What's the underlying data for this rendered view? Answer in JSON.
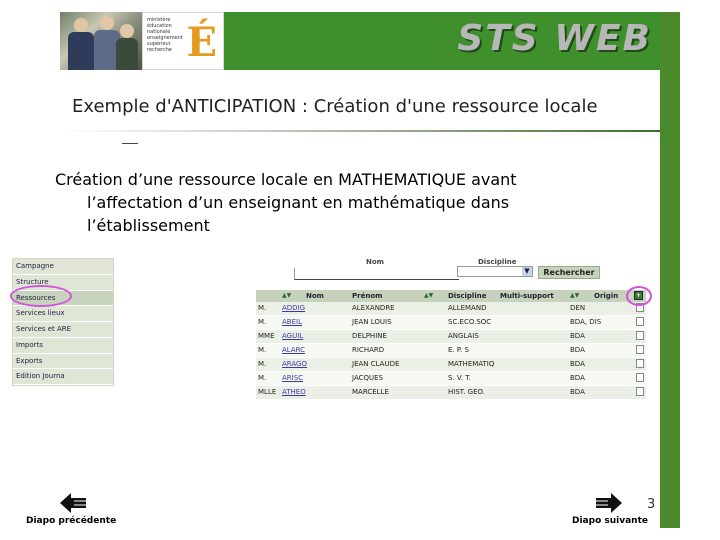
{
  "header": {
    "logo_text": [
      "ministère",
      "éducation",
      "nationale",
      "enseignement",
      "supérieur",
      "recherche"
    ],
    "logo_mark": "É",
    "brand": "STS WEB"
  },
  "slide": {
    "title": "Exemple d'ANTICIPATION : Création d'une ressource locale",
    "body_lines": [
      "Création d’une ressource locale en MATHEMATIQUE avant",
      "l’affectation d’un enseignant en mathématique dans",
      "l’établissement"
    ],
    "page_number": "3"
  },
  "menu": {
    "items": [
      "Campagne",
      "Structure",
      "Ressources",
      "Services lieux",
      "Services et ARE",
      "Imports",
      "Exports",
      "Edition Journa"
    ],
    "selected_index": 2
  },
  "search": {
    "nom_label": "Nom",
    "discipline_label": "Discipline",
    "nom_value": "",
    "discipline_value": "",
    "button_label": "Rechercher"
  },
  "table": {
    "headers": {
      "nom": "Nom",
      "prenom": "Prénom",
      "discipline": "Discipline",
      "multi": "Multi-support",
      "origine": "Origin"
    },
    "rows": [
      {
        "civ": "M.",
        "nom": "ADDIG",
        "prenom": "ALEXANDRE",
        "discipline": "ALLEMAND",
        "multi": "",
        "origine": "DEN"
      },
      {
        "civ": "M.",
        "nom": "ABEIL",
        "prenom": "JEAN LOUIS",
        "discipline": "SC.ECO.SOC",
        "multi": "",
        "origine": "BDA, DIS"
      },
      {
        "civ": "MME",
        "nom": "AGUIL",
        "prenom": "DELPHINE",
        "discipline": "ANGLAIS",
        "multi": "",
        "origine": "BDA"
      },
      {
        "civ": "M.",
        "nom": "ALARC",
        "prenom": "RICHARD",
        "discipline": "E. P. S",
        "multi": "",
        "origine": "BDA"
      },
      {
        "civ": "M.",
        "nom": "ARAGO",
        "prenom": "JEAN CLAUDE",
        "discipline": "MATHEMATIQ",
        "multi": "",
        "origine": "BDA"
      },
      {
        "civ": "M.",
        "nom": "ARISC",
        "prenom": "JACQUES",
        "discipline": "S. V. T.",
        "multi": "",
        "origine": "BDA"
      },
      {
        "civ": "MLLE",
        "nom": "ATHEO",
        "prenom": "MARCELLE",
        "discipline": "HIST. GEO.",
        "multi": "",
        "origine": "BDA"
      }
    ]
  },
  "footer": {
    "prev_label": "Diapo précédente",
    "next_label": "Diapo suivante"
  },
  "colors": {
    "brand_green": "#3f8f2c",
    "highlight": "#d253d8",
    "table_header": "#c6d2bc"
  }
}
